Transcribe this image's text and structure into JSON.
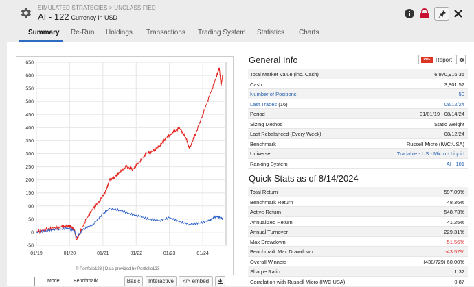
{
  "header": {
    "breadcrumb": "SIMULATED STRATEGIES > UNCLASSIFIED",
    "title": "AI - 122",
    "currency": "Currency in USD"
  },
  "tabs": [
    {
      "label": "Summary"
    },
    {
      "label": "Re-Run"
    },
    {
      "label": "Holdings"
    },
    {
      "label": "Transactions"
    },
    {
      "label": "Trading System"
    },
    {
      "label": "Statistics"
    },
    {
      "label": "Charts"
    }
  ],
  "general_info": {
    "title": "General Info",
    "report_label": "Report",
    "pdf_label": "PDF",
    "rows": [
      {
        "label": "Total Market Value (inc. Cash)",
        "value": "6,970,916.35"
      },
      {
        "label": "Cash",
        "value": "3,801.52"
      },
      {
        "label": "Number of Positions",
        "value": "50"
      },
      {
        "label": "Last Trades",
        "count": "(16)",
        "value": "08/12/24"
      },
      {
        "label": "Period",
        "value": "01/01/19 - 08/14/24"
      },
      {
        "label": "Sizing Method",
        "value": "Static Weight"
      },
      {
        "label": "Last Rebalanced (Every Week)",
        "value": "08/12/24"
      },
      {
        "label": "Benchmark",
        "value": "Russell Micro (IWC:USA)"
      },
      {
        "label": "Universe",
        "value": "Tradable - US - Micro - Liquid"
      },
      {
        "label": "Ranking System",
        "value": "AI - 101"
      }
    ]
  },
  "quick_stats": {
    "title": "Quick Stats as of 8/14/2024",
    "rows": [
      {
        "label": "Total Return",
        "value": "597.09%"
      },
      {
        "label": "Benchmark Return",
        "value": "48.36%"
      },
      {
        "label": "Active Return",
        "value": "548.73%"
      },
      {
        "label": "Annualized Return",
        "value": "41.25%"
      },
      {
        "label": "Annual Turnover",
        "value": "229.31%"
      },
      {
        "label": "Max Drawdown",
        "value": "-51.56%"
      },
      {
        "label": "Benchmark Max Drawdown",
        "value": "-43.57%"
      },
      {
        "label": "Overall Winners",
        "value": "(438/729) 60.00%"
      },
      {
        "label": "Sharpe Ratio",
        "value": "1.32"
      },
      {
        "label": "Correlation with Russell Micro (IWC:USA)",
        "value": "0.87"
      }
    ]
  },
  "chart_data": {
    "type": "line",
    "x_ticks": [
      "01/19",
      "01/20",
      "01/21",
      "01/22",
      "01/23",
      "01/24"
    ],
    "y_ticks": [
      650,
      600,
      550,
      500,
      450,
      400,
      350,
      300,
      250,
      200,
      150,
      100,
      50,
      0,
      -50
    ],
    "ylim": [
      -50,
      650
    ],
    "series": [
      {
        "name": "Model",
        "color": "#e3201b",
        "x": [
          2019.0,
          2019.25,
          2019.5,
          2019.75,
          2019.95,
          2020.05,
          2020.15,
          2020.2,
          2020.3,
          2020.5,
          2020.7,
          2020.9,
          2021.1,
          2021.2,
          2021.35,
          2021.5,
          2021.7,
          2021.9,
          2022.1,
          2022.3,
          2022.5,
          2022.7,
          2022.9,
          2023.1,
          2023.3,
          2023.5,
          2023.6,
          2023.8,
          2024.0,
          2024.2,
          2024.4,
          2024.5,
          2024.55,
          2024.6
        ],
        "y": [
          0,
          10,
          15,
          20,
          25,
          20,
          5,
          -30,
          -5,
          50,
          90,
          120,
          160,
          200,
          210,
          230,
          250,
          240,
          270,
          300,
          310,
          330,
          360,
          380,
          400,
          360,
          320,
          380,
          450,
          520,
          590,
          630,
          560,
          600
        ]
      },
      {
        "name": "Benchmark",
        "color": "#2c5fc9",
        "x": [
          2019.0,
          2019.3,
          2019.6,
          2019.95,
          2020.15,
          2020.2,
          2020.4,
          2020.7,
          2021.0,
          2021.2,
          2021.5,
          2021.8,
          2022.1,
          2022.4,
          2022.7,
          2023.0,
          2023.3,
          2023.6,
          2023.9,
          2024.2,
          2024.4,
          2024.55,
          2024.6
        ],
        "y": [
          0,
          5,
          10,
          15,
          5,
          -20,
          10,
          30,
          70,
          90,
          85,
          70,
          60,
          50,
          45,
          55,
          40,
          30,
          35,
          45,
          60,
          55,
          50
        ]
      }
    ]
  },
  "chart_credit": "© Portfolio123 | Data provided by Portfolio123",
  "chart_buttons": {
    "basic": "Basic",
    "interactive": "Interactive",
    "embed": "</> embed"
  }
}
